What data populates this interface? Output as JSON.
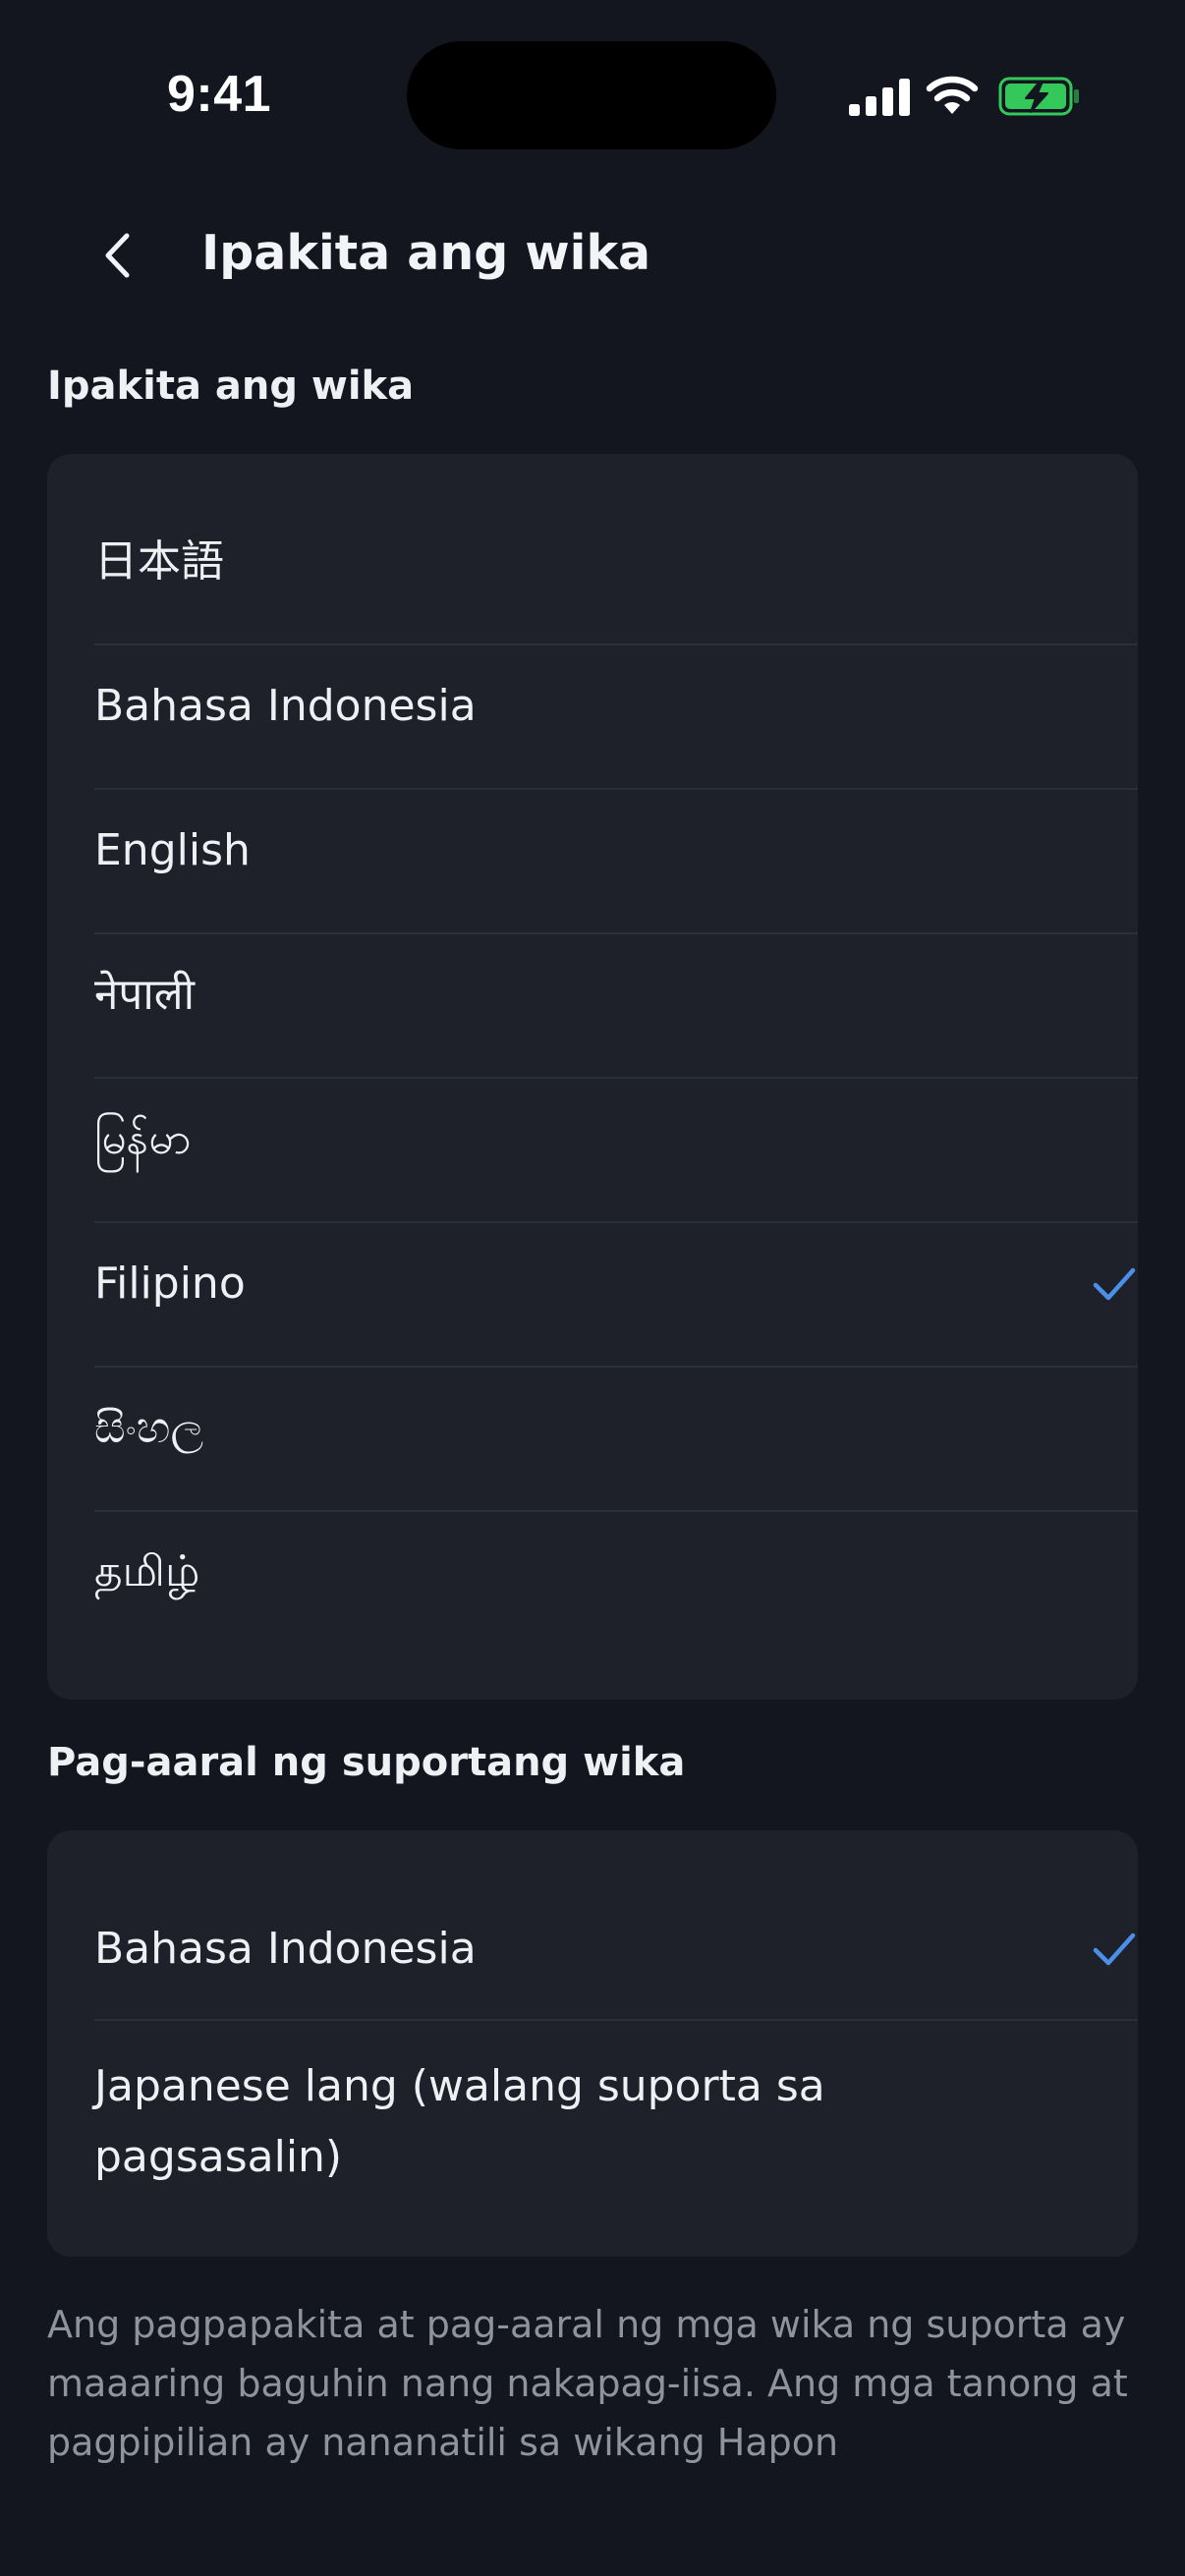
{
  "status_bar": {
    "time": "9:41"
  },
  "header": {
    "title": "Ipakita ang wika"
  },
  "display_language": {
    "heading": "Ipakita ang wika",
    "options": [
      {
        "label": "日本語",
        "selected": false
      },
      {
        "label": "Bahasa Indonesia",
        "selected": false
      },
      {
        "label": "English",
        "selected": false
      },
      {
        "label": "नेपाली",
        "selected": false
      },
      {
        "label": "မြန်မာ",
        "selected": false
      },
      {
        "label": "Filipino",
        "selected": true
      },
      {
        "label": "සිංහල",
        "selected": false
      },
      {
        "label": "தமிழ்",
        "selected": false
      }
    ]
  },
  "support_language": {
    "heading": "Pag-aaral ng suportang wika",
    "options": [
      {
        "label": "Bahasa Indonesia",
        "selected": true
      },
      {
        "label": "Japanese lang (walang suporta sa pagsasalin)",
        "selected": false
      }
    ]
  },
  "footnote": "Ang pagpapakita at pag-aaral ng mga wika ng suporta ay maaaring baguhin nang nakapag-iisa. Ang mga tanong at pagpipilian ay nananatili sa wikang Hapon",
  "colors": {
    "background": "#13161e",
    "card": "#1e212a",
    "accent": "#4a8fe8",
    "battery": "#34c759"
  }
}
